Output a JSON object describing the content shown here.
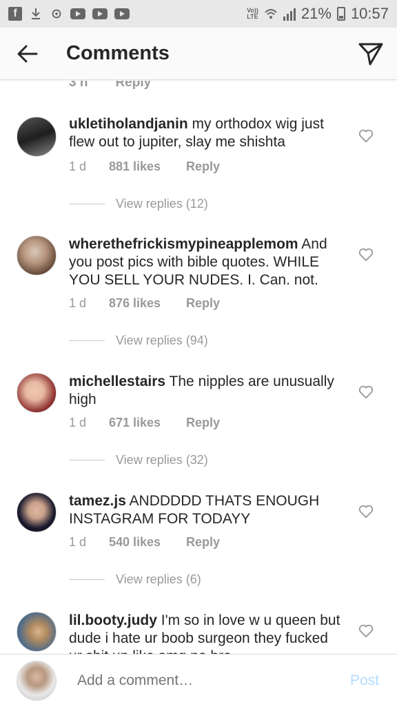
{
  "status_bar": {
    "lte": "Vo))\nLTE",
    "battery": "21%",
    "time": "10:57"
  },
  "header": {
    "title": "Comments"
  },
  "partial_row": {
    "time": "3 h",
    "reply": "Reply"
  },
  "comments": [
    {
      "username": "ukletiholandjanin",
      "text": " my orthodox wig just flew out to jupiter, slay me shishta",
      "time": "1 d",
      "likes": "881 likes",
      "reply": "Reply",
      "view_replies": "View replies (12)",
      "avatar_colors": [
        "#2a2a2a",
        "#777777"
      ]
    },
    {
      "username": "wherethefrickismypineapplemom",
      "text": " And you post pics with bible quotes. WHILE YOU SELL YOUR NUDES. I. Can. not.",
      "time": "1 d",
      "likes": "876 likes",
      "reply": "Reply",
      "view_replies": "View replies (94)",
      "avatar_colors": [
        "#6b4e3d",
        "#d9c7b8"
      ]
    },
    {
      "username": "michellestairs",
      "text": " The nipples are unusually high",
      "time": "1 d",
      "likes": "671 likes",
      "reply": "Reply",
      "view_replies": "View replies (32)",
      "avatar_colors": [
        "#8a2a2a",
        "#e6b8a2"
      ]
    },
    {
      "username": "tamez.js",
      "text": " ANDDDDD THATS ENOUGH INSTAGRAM FOR TODAYY",
      "time": "1 d",
      "likes": "540 likes",
      "reply": "Reply",
      "view_replies": "View replies (6)",
      "avatar_colors": [
        "#1a1a2e",
        "#c9a08a"
      ]
    },
    {
      "username": "lil.booty.judy",
      "text": " I'm so in love w u queen but dude i hate ur boob surgeon they fucked ur shit up like omg no bro",
      "avatar_colors": [
        "#4a6a8a",
        "#d8b48a"
      ]
    }
  ],
  "footer": {
    "placeholder": "Add a comment…",
    "post": "Post"
  },
  "colors": {
    "accent_disabled": "#b3dbff",
    "secondary_text": "#999999",
    "primary_text": "#262626"
  },
  "icons": [
    "facebook-icon",
    "download-icon",
    "sync-icon",
    "youtube-icon",
    "wifi-icon",
    "signal-icon",
    "battery-icon",
    "back-arrow-icon",
    "direct-send-icon",
    "heart-icon"
  ]
}
